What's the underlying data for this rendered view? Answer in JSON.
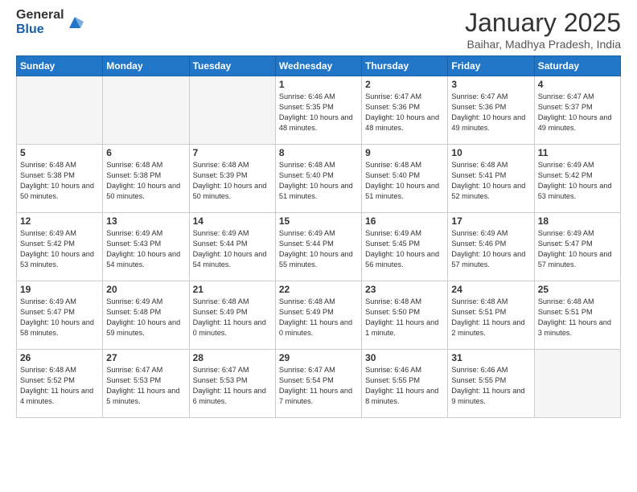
{
  "logo": {
    "general": "General",
    "blue": "Blue"
  },
  "title": "January 2025",
  "location": "Baihar, Madhya Pradesh, India",
  "days": [
    "Sunday",
    "Monday",
    "Tuesday",
    "Wednesday",
    "Thursday",
    "Friday",
    "Saturday"
  ],
  "weeks": [
    [
      {
        "day": "",
        "empty": true
      },
      {
        "day": "",
        "empty": true
      },
      {
        "day": "",
        "empty": true
      },
      {
        "day": "1",
        "sunrise": "Sunrise: 6:46 AM",
        "sunset": "Sunset: 5:35 PM",
        "daylight": "Daylight: 10 hours and 48 minutes."
      },
      {
        "day": "2",
        "sunrise": "Sunrise: 6:47 AM",
        "sunset": "Sunset: 5:36 PM",
        "daylight": "Daylight: 10 hours and 48 minutes."
      },
      {
        "day": "3",
        "sunrise": "Sunrise: 6:47 AM",
        "sunset": "Sunset: 5:36 PM",
        "daylight": "Daylight: 10 hours and 49 minutes."
      },
      {
        "day": "4",
        "sunrise": "Sunrise: 6:47 AM",
        "sunset": "Sunset: 5:37 PM",
        "daylight": "Daylight: 10 hours and 49 minutes."
      }
    ],
    [
      {
        "day": "5",
        "sunrise": "Sunrise: 6:48 AM",
        "sunset": "Sunset: 5:38 PM",
        "daylight": "Daylight: 10 hours and 50 minutes."
      },
      {
        "day": "6",
        "sunrise": "Sunrise: 6:48 AM",
        "sunset": "Sunset: 5:38 PM",
        "daylight": "Daylight: 10 hours and 50 minutes."
      },
      {
        "day": "7",
        "sunrise": "Sunrise: 6:48 AM",
        "sunset": "Sunset: 5:39 PM",
        "daylight": "Daylight: 10 hours and 50 minutes."
      },
      {
        "day": "8",
        "sunrise": "Sunrise: 6:48 AM",
        "sunset": "Sunset: 5:40 PM",
        "daylight": "Daylight: 10 hours and 51 minutes."
      },
      {
        "day": "9",
        "sunrise": "Sunrise: 6:48 AM",
        "sunset": "Sunset: 5:40 PM",
        "daylight": "Daylight: 10 hours and 51 minutes."
      },
      {
        "day": "10",
        "sunrise": "Sunrise: 6:48 AM",
        "sunset": "Sunset: 5:41 PM",
        "daylight": "Daylight: 10 hours and 52 minutes."
      },
      {
        "day": "11",
        "sunrise": "Sunrise: 6:49 AM",
        "sunset": "Sunset: 5:42 PM",
        "daylight": "Daylight: 10 hours and 53 minutes."
      }
    ],
    [
      {
        "day": "12",
        "sunrise": "Sunrise: 6:49 AM",
        "sunset": "Sunset: 5:42 PM",
        "daylight": "Daylight: 10 hours and 53 minutes."
      },
      {
        "day": "13",
        "sunrise": "Sunrise: 6:49 AM",
        "sunset": "Sunset: 5:43 PM",
        "daylight": "Daylight: 10 hours and 54 minutes."
      },
      {
        "day": "14",
        "sunrise": "Sunrise: 6:49 AM",
        "sunset": "Sunset: 5:44 PM",
        "daylight": "Daylight: 10 hours and 54 minutes."
      },
      {
        "day": "15",
        "sunrise": "Sunrise: 6:49 AM",
        "sunset": "Sunset: 5:44 PM",
        "daylight": "Daylight: 10 hours and 55 minutes."
      },
      {
        "day": "16",
        "sunrise": "Sunrise: 6:49 AM",
        "sunset": "Sunset: 5:45 PM",
        "daylight": "Daylight: 10 hours and 56 minutes."
      },
      {
        "day": "17",
        "sunrise": "Sunrise: 6:49 AM",
        "sunset": "Sunset: 5:46 PM",
        "daylight": "Daylight: 10 hours and 57 minutes."
      },
      {
        "day": "18",
        "sunrise": "Sunrise: 6:49 AM",
        "sunset": "Sunset: 5:47 PM",
        "daylight": "Daylight: 10 hours and 57 minutes."
      }
    ],
    [
      {
        "day": "19",
        "sunrise": "Sunrise: 6:49 AM",
        "sunset": "Sunset: 5:47 PM",
        "daylight": "Daylight: 10 hours and 58 minutes."
      },
      {
        "day": "20",
        "sunrise": "Sunrise: 6:49 AM",
        "sunset": "Sunset: 5:48 PM",
        "daylight": "Daylight: 10 hours and 59 minutes."
      },
      {
        "day": "21",
        "sunrise": "Sunrise: 6:48 AM",
        "sunset": "Sunset: 5:49 PM",
        "daylight": "Daylight: 11 hours and 0 minutes."
      },
      {
        "day": "22",
        "sunrise": "Sunrise: 6:48 AM",
        "sunset": "Sunset: 5:49 PM",
        "daylight": "Daylight: 11 hours and 0 minutes."
      },
      {
        "day": "23",
        "sunrise": "Sunrise: 6:48 AM",
        "sunset": "Sunset: 5:50 PM",
        "daylight": "Daylight: 11 hours and 1 minute."
      },
      {
        "day": "24",
        "sunrise": "Sunrise: 6:48 AM",
        "sunset": "Sunset: 5:51 PM",
        "daylight": "Daylight: 11 hours and 2 minutes."
      },
      {
        "day": "25",
        "sunrise": "Sunrise: 6:48 AM",
        "sunset": "Sunset: 5:51 PM",
        "daylight": "Daylight: 11 hours and 3 minutes."
      }
    ],
    [
      {
        "day": "26",
        "sunrise": "Sunrise: 6:48 AM",
        "sunset": "Sunset: 5:52 PM",
        "daylight": "Daylight: 11 hours and 4 minutes."
      },
      {
        "day": "27",
        "sunrise": "Sunrise: 6:47 AM",
        "sunset": "Sunset: 5:53 PM",
        "daylight": "Daylight: 11 hours and 5 minutes."
      },
      {
        "day": "28",
        "sunrise": "Sunrise: 6:47 AM",
        "sunset": "Sunset: 5:53 PM",
        "daylight": "Daylight: 11 hours and 6 minutes."
      },
      {
        "day": "29",
        "sunrise": "Sunrise: 6:47 AM",
        "sunset": "Sunset: 5:54 PM",
        "daylight": "Daylight: 11 hours and 7 minutes."
      },
      {
        "day": "30",
        "sunrise": "Sunrise: 6:46 AM",
        "sunset": "Sunset: 5:55 PM",
        "daylight": "Daylight: 11 hours and 8 minutes."
      },
      {
        "day": "31",
        "sunrise": "Sunrise: 6:46 AM",
        "sunset": "Sunset: 5:55 PM",
        "daylight": "Daylight: 11 hours and 9 minutes."
      },
      {
        "day": "",
        "empty": true
      }
    ]
  ]
}
